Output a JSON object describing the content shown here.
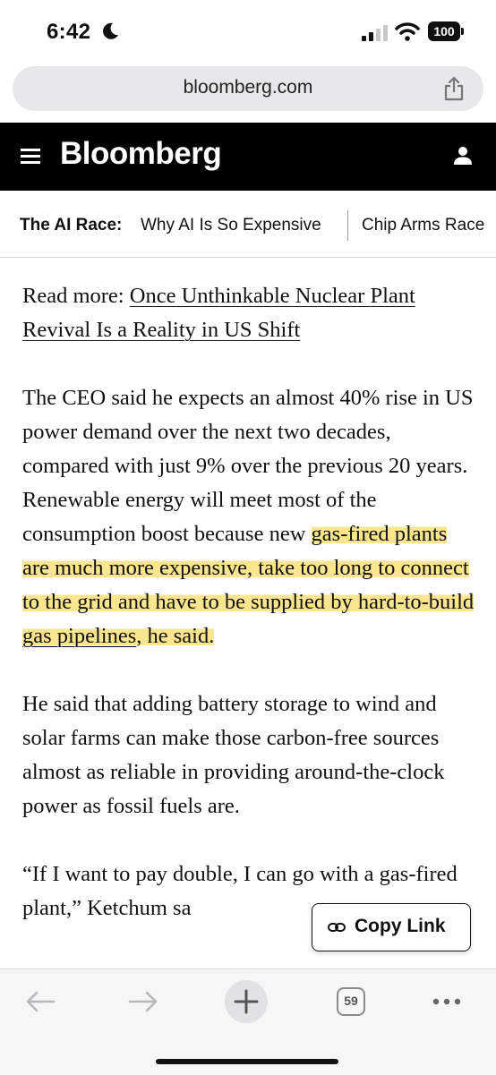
{
  "status_bar": {
    "time": "6:42",
    "battery": "100"
  },
  "browser": {
    "url": "bloomberg.com",
    "tab_count": "59"
  },
  "header": {
    "brand": "Bloomberg"
  },
  "ticker": {
    "label": "The AI Race:",
    "items": [
      "Why AI Is So Expensive",
      "Chip Arms Race"
    ]
  },
  "article": {
    "read_more_prefix": "Read more: ",
    "read_more_link": "Once Unthinkable Nuclear Plant Revival Is a Reality in US Shift",
    "p2_part1": "The CEO said he expects an almost 40% rise in US power demand over the next two decades, compared with just 9% over the previous 20 years. Renewable energy will meet most of the consumption boost because new ",
    "p2_highlight1": "gas-fired plants are much more expensive, take too long to connect to the grid and have to be supplied by hard-to-build ",
    "p2_link": "gas pipelines",
    "p2_highlight2": ", he said.",
    "p3": "He said that adding battery storage to wind and solar farms can make those carbon-free sources almost as reliable in providing around-the-clock power as fossil fuels are.",
    "p4": "“If I want to pay double, I can go with a gas-fired plant,” Ketchum sa"
  },
  "copy_link": {
    "label": "Copy Link"
  },
  "icons": {
    "moon": "moon-icon",
    "signal": "signal-icon",
    "wifi": "wifi-icon",
    "share": "share-icon",
    "menu": "hamburger-menu-icon",
    "user": "user-icon",
    "link": "link-icon",
    "back": "back-arrow-icon",
    "forward": "forward-arrow-icon",
    "new_tab": "plus-icon",
    "more": "more-dots-icon"
  },
  "colors": {
    "highlight": "#fbe58e",
    "header_bg": "#000000",
    "toolbar_bg": "#f6f6f7"
  }
}
